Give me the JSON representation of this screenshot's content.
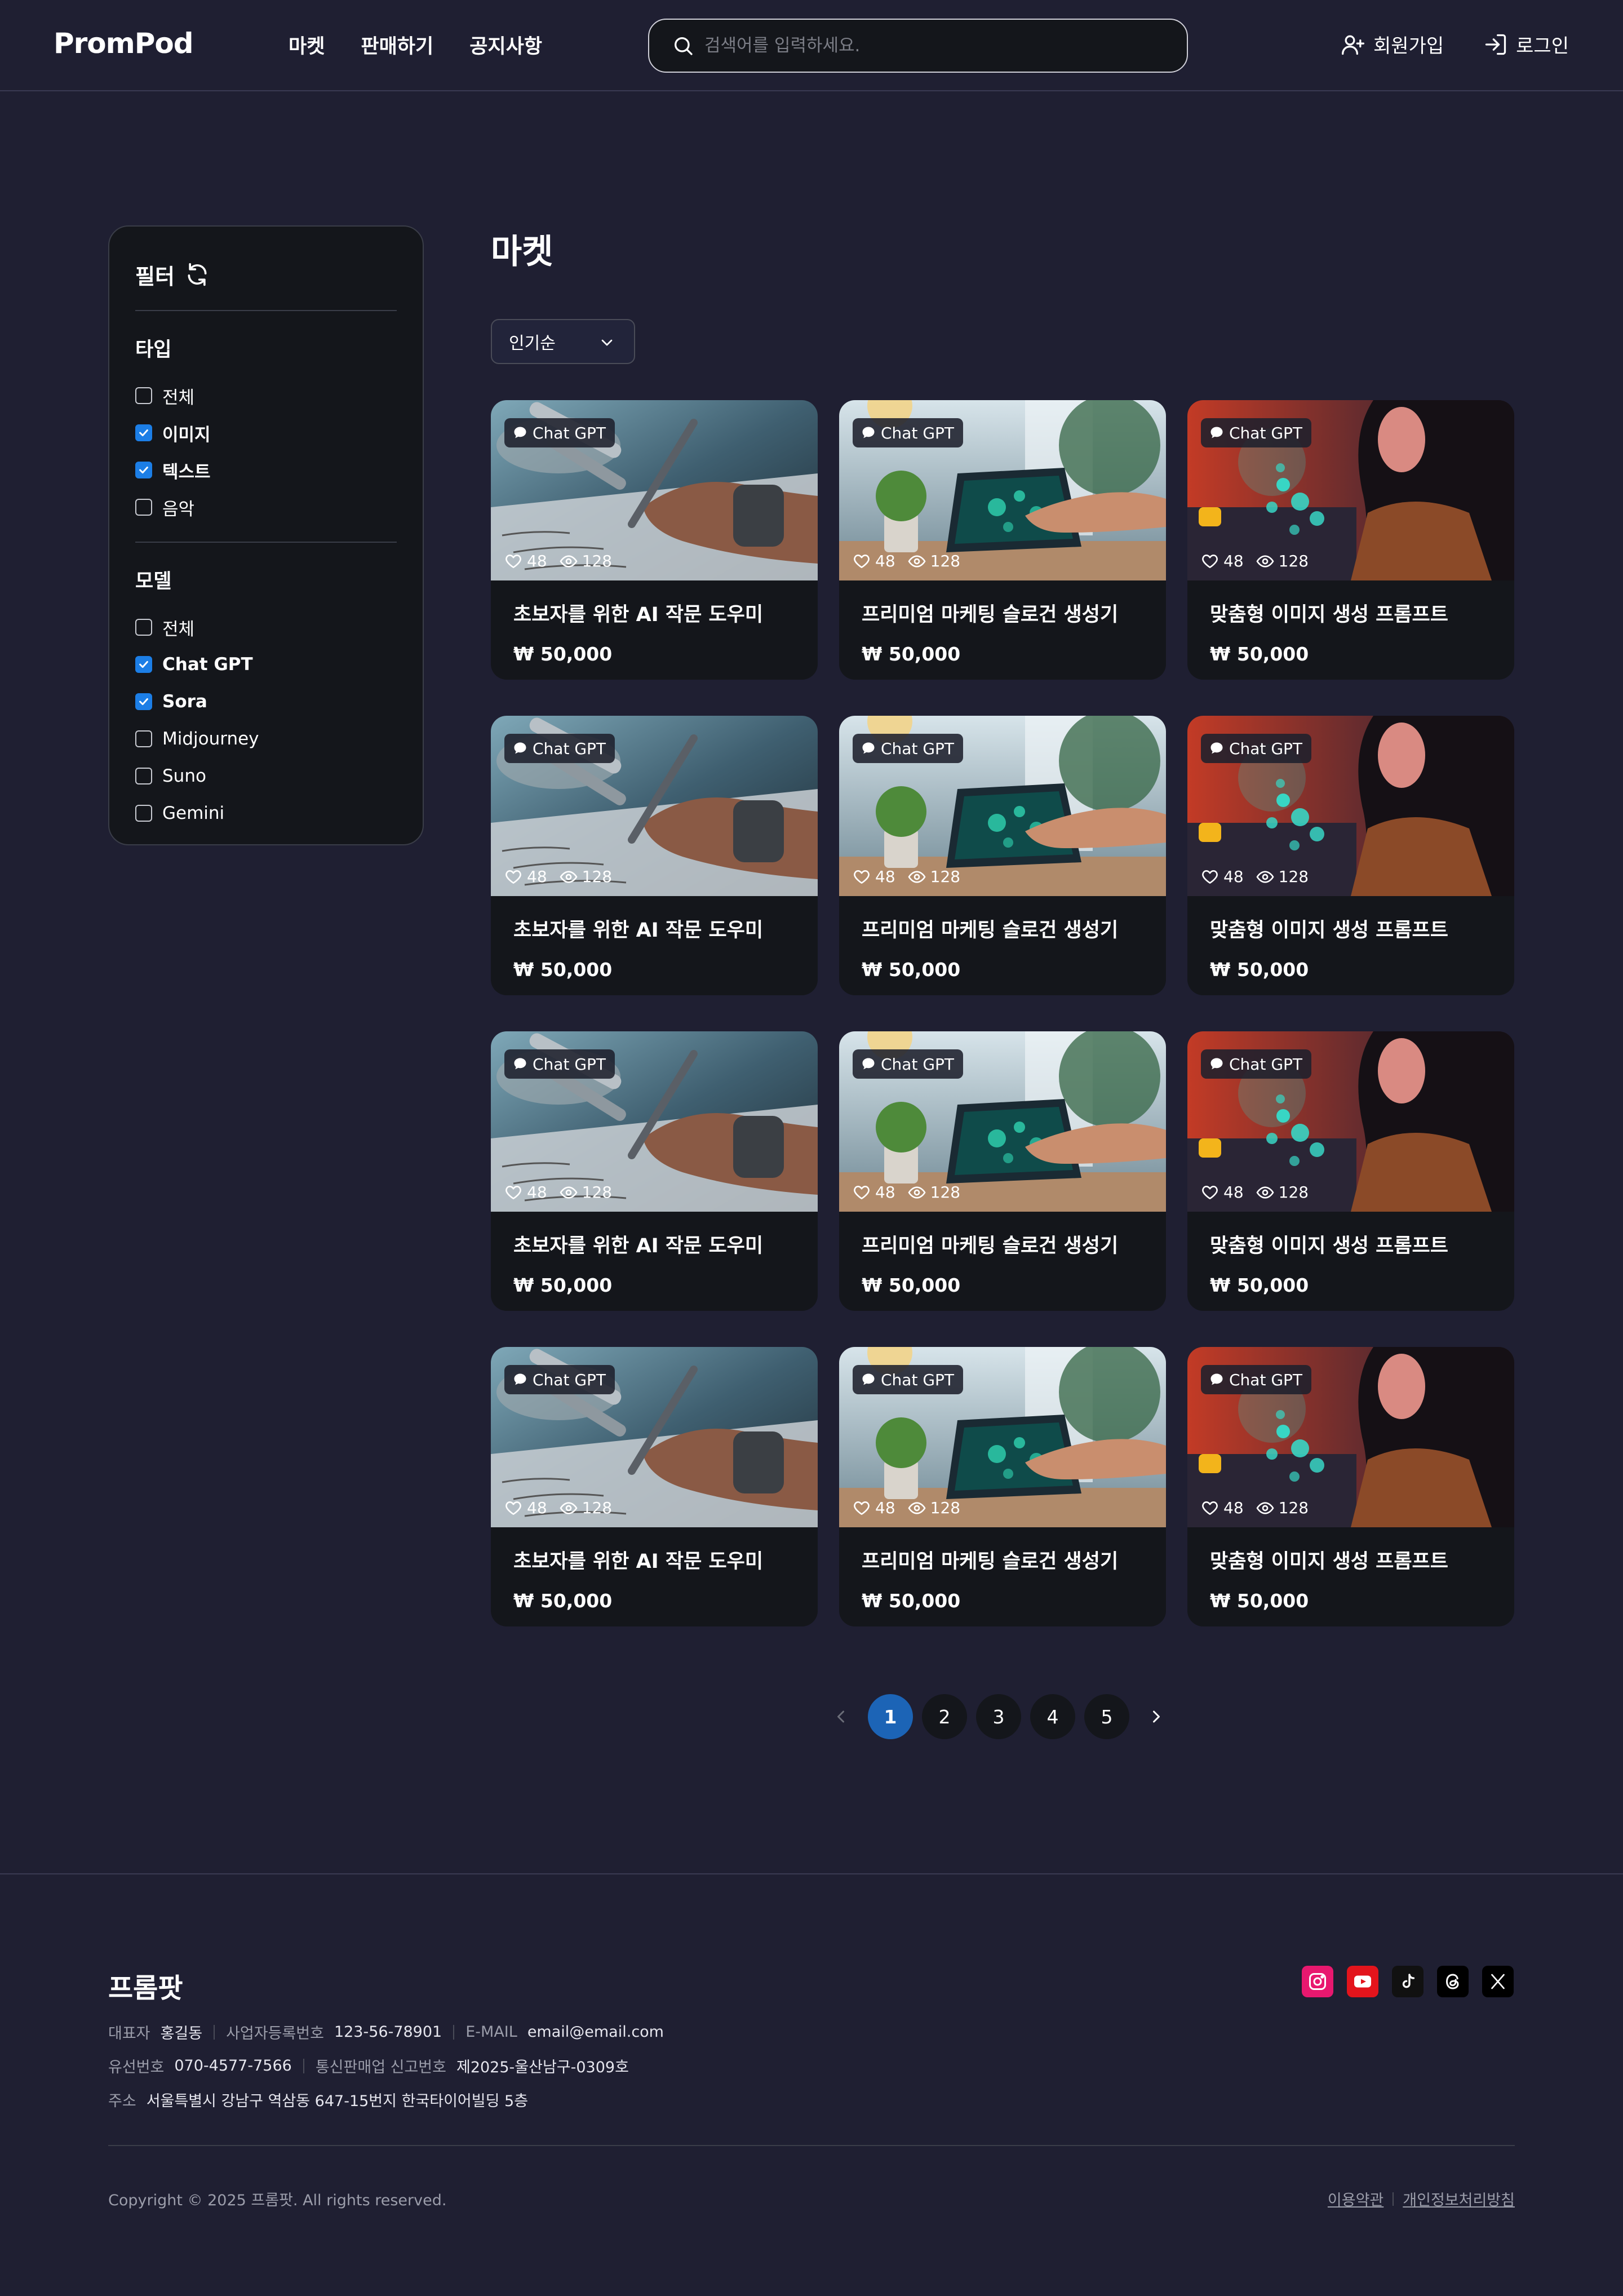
{
  "header": {
    "logo": "PromPod",
    "nav": [
      "마켓",
      "판매하기",
      "공지사항"
    ],
    "search_placeholder": "검색어를 입력하세요.",
    "signup_label": "회원가입",
    "login_label": "로그인"
  },
  "sidebar": {
    "title": "필터",
    "type_title": "타입",
    "type_options": [
      {
        "label": "전체",
        "checked": false
      },
      {
        "label": "이미지",
        "checked": true
      },
      {
        "label": "텍스트",
        "checked": true
      },
      {
        "label": "음악",
        "checked": false
      }
    ],
    "model_title": "모델",
    "model_options": [
      {
        "label": "전체",
        "checked": false
      },
      {
        "label": "Chat GPT",
        "checked": true
      },
      {
        "label": "Sora",
        "checked": true
      },
      {
        "label": "Midjourney",
        "checked": false
      },
      {
        "label": "Suno",
        "checked": false
      },
      {
        "label": "Gemini",
        "checked": false
      }
    ]
  },
  "main": {
    "title": "마켓",
    "sort_value": "인기순",
    "cards": [
      {
        "badge": "Chat GPT",
        "likes": "48",
        "views": "128",
        "title": "초보자를 위한 AI 작문 도우미",
        "price": "₩ 50,000",
        "image": "robot-hand-writing"
      },
      {
        "badge": "Chat GPT",
        "likes": "48",
        "views": "128",
        "title": "프리미엄 마케팅 슬로건 생성기",
        "price": "₩ 50,000",
        "image": "tablet-plant"
      },
      {
        "badge": "Chat GPT",
        "likes": "48",
        "views": "128",
        "title": "맞춤형 이미지 생성 프롬프트",
        "price": "₩ 50,000",
        "image": "woman-hologram"
      },
      {
        "badge": "Chat GPT",
        "likes": "48",
        "views": "128",
        "title": "초보자를 위한 AI 작문 도우미",
        "price": "₩ 50,000",
        "image": "robot-hand-writing"
      },
      {
        "badge": "Chat GPT",
        "likes": "48",
        "views": "128",
        "title": "프리미엄 마케팅 슬로건 생성기",
        "price": "₩ 50,000",
        "image": "tablet-plant"
      },
      {
        "badge": "Chat GPT",
        "likes": "48",
        "views": "128",
        "title": "맞춤형 이미지 생성 프롬프트",
        "price": "₩ 50,000",
        "image": "woman-hologram"
      },
      {
        "badge": "Chat GPT",
        "likes": "48",
        "views": "128",
        "title": "초보자를 위한 AI 작문 도우미",
        "price": "₩ 50,000",
        "image": "robot-hand-writing"
      },
      {
        "badge": "Chat GPT",
        "likes": "48",
        "views": "128",
        "title": "프리미엄 마케팅 슬로건 생성기",
        "price": "₩ 50,000",
        "image": "tablet-plant"
      },
      {
        "badge": "Chat GPT",
        "likes": "48",
        "views": "128",
        "title": "맞춤형 이미지 생성 프롬프트",
        "price": "₩ 50,000",
        "image": "woman-hologram"
      },
      {
        "badge": "Chat GPT",
        "likes": "48",
        "views": "128",
        "title": "초보자를 위한 AI 작문 도우미",
        "price": "₩ 50,000",
        "image": "robot-hand-writing"
      },
      {
        "badge": "Chat GPT",
        "likes": "48",
        "views": "128",
        "title": "프리미엄 마케팅 슬로건 생성기",
        "price": "₩ 50,000",
        "image": "tablet-plant"
      },
      {
        "badge": "Chat GPT",
        "likes": "48",
        "views": "128",
        "title": "맞춤형 이미지 생성 프롬프트",
        "price": "₩ 50,000",
        "image": "woman-hologram"
      }
    ]
  },
  "pagination": {
    "pages": [
      "1",
      "2",
      "3",
      "4",
      "5"
    ],
    "active": "1"
  },
  "footer": {
    "brand": "프롬팟",
    "ceo_label": "대표자",
    "ceo": "홍길동",
    "bizno_label": "사업자등록번호",
    "bizno": "123-56-78901",
    "email_label": "E-MAIL",
    "email": "email@email.com",
    "phone_label": "유선번호",
    "phone": "070-4577-7566",
    "mailorder_label": "통신판매업 신고번호",
    "mailorder": "제2025-울산남구-0309호",
    "address_label": "주소",
    "address": "서울특별시 강남구 역삼동 647-15번지 한국타이어빌딩 5층",
    "copyright": "Copyright © 2025 프롬팟. All rights reserved.",
    "terms": "이용약관",
    "privacy": "개인정보처리방침",
    "socials": [
      "instagram-icon",
      "youtube-icon",
      "tiktok-icon",
      "threads-icon",
      "x-icon"
    ]
  },
  "colors": {
    "background": "#1f1f32",
    "panel": "#14161b",
    "accent": "#1c7ee6",
    "active_page": "#1c64b6"
  }
}
